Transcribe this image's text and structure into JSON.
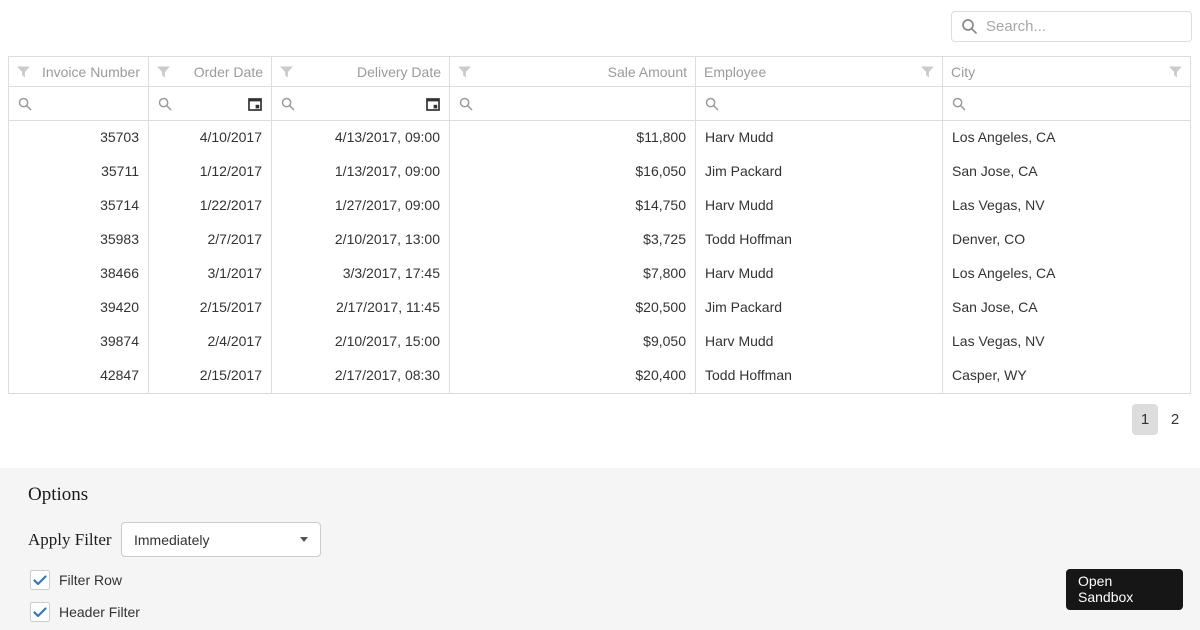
{
  "colors": {
    "accent_blue": "#337ab7",
    "border": "#dddddd",
    "header_text": "#9b9b9b",
    "cell_text": "#333333",
    "panel_bg": "#f5f5f5",
    "button_bg": "#161616",
    "pager_selected_bg": "#dddddd"
  },
  "icons": {
    "search": "magnifier-glyph",
    "header_filter": "funnel-glyph",
    "calendar": "calendar-glyph",
    "caret": "triangle-down",
    "check": "blue-checkmark"
  },
  "search": {
    "placeholder": "Search..."
  },
  "grid": {
    "columns": [
      {
        "label": "Invoice Number",
        "align": "right",
        "filter_icon": "left",
        "has_calendar": false
      },
      {
        "label": "Order Date",
        "align": "right",
        "filter_icon": "left",
        "has_calendar": true
      },
      {
        "label": "Delivery Date",
        "align": "right",
        "filter_icon": "left",
        "has_calendar": true
      },
      {
        "label": "Sale Amount",
        "align": "right",
        "filter_icon": "left",
        "has_calendar": false
      },
      {
        "label": "Employee",
        "align": "left",
        "filter_icon": "right",
        "has_calendar": false
      },
      {
        "label": "City",
        "align": "left",
        "filter_icon": "right",
        "has_calendar": false
      }
    ],
    "rows": [
      [
        "35703",
        "4/10/2017",
        "4/13/2017, 09:00",
        "$11,800",
        "Harv Mudd",
        "Los Angeles, CA"
      ],
      [
        "35711",
        "1/12/2017",
        "1/13/2017, 09:00",
        "$16,050",
        "Jim Packard",
        "San Jose, CA"
      ],
      [
        "35714",
        "1/22/2017",
        "1/27/2017, 09:00",
        "$14,750",
        "Harv Mudd",
        "Las Vegas, NV"
      ],
      [
        "35983",
        "2/7/2017",
        "2/10/2017, 13:00",
        "$3,725",
        "Todd Hoffman",
        "Denver, CO"
      ],
      [
        "38466",
        "3/1/2017",
        "3/3/2017, 17:45",
        "$7,800",
        "Harv Mudd",
        "Los Angeles, CA"
      ],
      [
        "39420",
        "2/15/2017",
        "2/17/2017, 11:45",
        "$20,500",
        "Jim Packard",
        "San Jose, CA"
      ],
      [
        "39874",
        "2/4/2017",
        "2/10/2017, 15:00",
        "$9,050",
        "Harv Mudd",
        "Las Vegas, NV"
      ],
      [
        "42847",
        "2/15/2017",
        "2/17/2017, 08:30",
        "$20,400",
        "Todd Hoffman",
        "Casper, WY"
      ]
    ]
  },
  "pager": {
    "pages": [
      "1",
      "2"
    ],
    "current": "1"
  },
  "options": {
    "title": "Options",
    "apply_filter_label": "Apply Filter",
    "apply_filter_value": "Immediately",
    "checkboxes": [
      {
        "label": "Filter Row",
        "checked": true
      },
      {
        "label": "Header Filter",
        "checked": true
      }
    ]
  },
  "sandbox_button": {
    "label": "Open Sandbox"
  }
}
